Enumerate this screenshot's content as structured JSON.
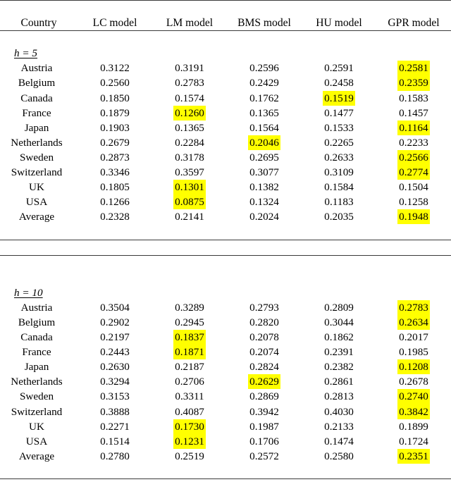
{
  "table": {
    "columns": [
      "Country",
      "LC model",
      "LM model",
      "BMS model",
      "HU model",
      "GPR model"
    ],
    "highlight_color": "#ffff00",
    "sections": [
      {
        "label": "h = 5",
        "rows": [
          {
            "country": "Austria",
            "values": [
              "0.3122",
              "0.3191",
              "0.2596",
              "0.2591",
              "0.2581"
            ],
            "highlight": [
              false,
              false,
              false,
              false,
              true
            ]
          },
          {
            "country": "Belgium",
            "values": [
              "0.2560",
              "0.2783",
              "0.2429",
              "0.2458",
              "0.2359"
            ],
            "highlight": [
              false,
              false,
              false,
              false,
              true
            ]
          },
          {
            "country": "Canada",
            "values": [
              "0.1850",
              "0.1574",
              "0.1762",
              "0.1519",
              "0.1583"
            ],
            "highlight": [
              false,
              false,
              false,
              true,
              false
            ]
          },
          {
            "country": "France",
            "values": [
              "0.1879",
              "0.1260",
              "0.1365",
              "0.1477",
              "0.1457"
            ],
            "highlight": [
              false,
              true,
              false,
              false,
              false
            ]
          },
          {
            "country": "Japan",
            "values": [
              "0.1903",
              "0.1365",
              "0.1564",
              "0.1533",
              "0.1164"
            ],
            "highlight": [
              false,
              false,
              false,
              false,
              true
            ]
          },
          {
            "country": "Netherlands",
            "values": [
              "0.2679",
              "0.2284",
              "0.2046",
              "0.2265",
              "0.2233"
            ],
            "highlight": [
              false,
              false,
              true,
              false,
              false
            ]
          },
          {
            "country": "Sweden",
            "values": [
              "0.2873",
              "0.3178",
              "0.2695",
              "0.2633",
              "0.2566"
            ],
            "highlight": [
              false,
              false,
              false,
              false,
              true
            ]
          },
          {
            "country": "Switzerland",
            "values": [
              "0.3346",
              "0.3597",
              "0.3077",
              "0.3109",
              "0.2774"
            ],
            "highlight": [
              false,
              false,
              false,
              false,
              true
            ]
          },
          {
            "country": "UK",
            "values": [
              "0.1805",
              "0.1301",
              "0.1382",
              "0.1584",
              "0.1504"
            ],
            "highlight": [
              false,
              true,
              false,
              false,
              false
            ]
          },
          {
            "country": "USA",
            "values": [
              "0.1266",
              "0.0875",
              "0.1324",
              "0.1183",
              "0.1258"
            ],
            "highlight": [
              false,
              true,
              false,
              false,
              false
            ]
          },
          {
            "country": "Average",
            "values": [
              "0.2328",
              "0.2141",
              "0.2024",
              "0.2035",
              "0.1948"
            ],
            "highlight": [
              false,
              false,
              false,
              false,
              true
            ]
          }
        ]
      },
      {
        "label": "h = 10",
        "rows": [
          {
            "country": "Austria",
            "values": [
              "0.3504",
              "0.3289",
              "0.2793",
              "0.2809",
              "0.2783"
            ],
            "highlight": [
              false,
              false,
              false,
              false,
              true
            ]
          },
          {
            "country": "Belgium",
            "values": [
              "0.2902",
              "0.2945",
              "0.2820",
              "0.3044",
              "0.2634"
            ],
            "highlight": [
              false,
              false,
              false,
              false,
              true
            ]
          },
          {
            "country": "Canada",
            "values": [
              "0.2197",
              "0.1837",
              "0.2078",
              "0.1862",
              "0.2017"
            ],
            "highlight": [
              false,
              true,
              false,
              false,
              false
            ]
          },
          {
            "country": "France",
            "values": [
              "0.2443",
              "0.1871",
              "0.2074",
              "0.2391",
              "0.1985"
            ],
            "highlight": [
              false,
              true,
              false,
              false,
              false
            ]
          },
          {
            "country": "Japan",
            "values": [
              "0.2630",
              "0.2187",
              "0.2824",
              "0.2382",
              "0.1208"
            ],
            "highlight": [
              false,
              false,
              false,
              false,
              true
            ]
          },
          {
            "country": "Netherlands",
            "values": [
              "0.3294",
              "0.2706",
              "0.2629",
              "0.2861",
              "0.2678"
            ],
            "highlight": [
              false,
              false,
              true,
              false,
              false
            ]
          },
          {
            "country": "Sweden",
            "values": [
              "0.3153",
              "0.3311",
              "0.2869",
              "0.2813",
              "0.2740"
            ],
            "highlight": [
              false,
              false,
              false,
              false,
              true
            ]
          },
          {
            "country": "Switzerland",
            "values": [
              "0.3888",
              "0.4087",
              "0.3942",
              "0.4030",
              "0.3842"
            ],
            "highlight": [
              false,
              false,
              false,
              false,
              true
            ]
          },
          {
            "country": "UK",
            "values": [
              "0.2271",
              "0.1730",
              "0.1987",
              "0.2133",
              "0.1899"
            ],
            "highlight": [
              false,
              true,
              false,
              false,
              false
            ]
          },
          {
            "country": "USA",
            "values": [
              "0.1514",
              "0.1231",
              "0.1706",
              "0.1474",
              "0.1724"
            ],
            "highlight": [
              false,
              true,
              false,
              false,
              false
            ]
          },
          {
            "country": "Average",
            "values": [
              "0.2780",
              "0.2519",
              "0.2572",
              "0.2580",
              "0.2351"
            ],
            "highlight": [
              false,
              false,
              false,
              false,
              true
            ]
          }
        ]
      }
    ]
  }
}
